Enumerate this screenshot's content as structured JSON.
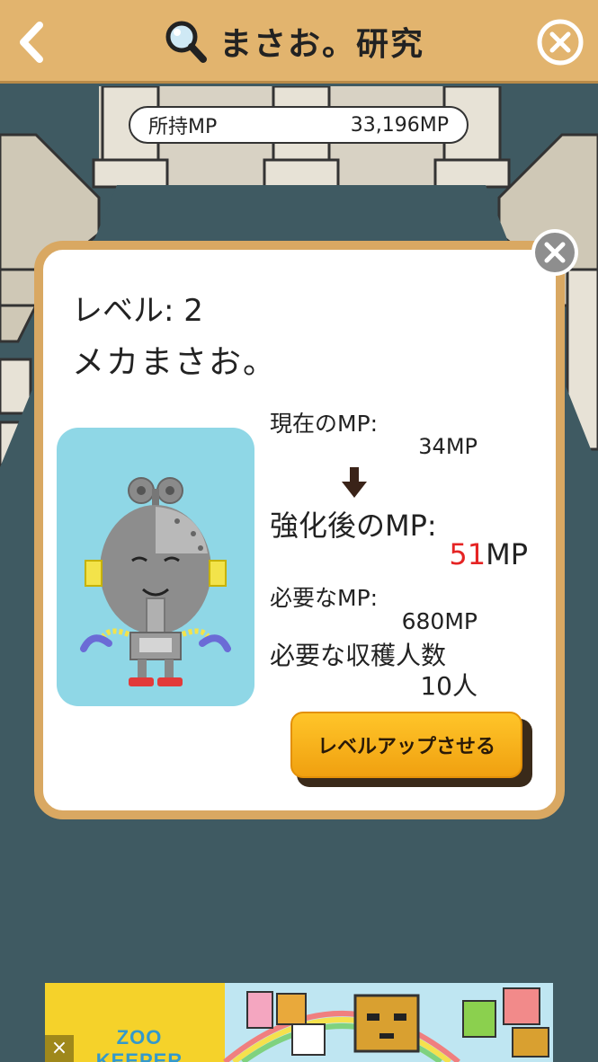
{
  "header": {
    "title": "まさお。研究",
    "back_icon": "chevron-left-icon",
    "search_icon": "magnifier-icon",
    "close_icon": "close-circle-icon"
  },
  "mp_holdings": {
    "label": "所持MP",
    "value": "33,196MP"
  },
  "modal": {
    "level_text": "レベル: 2",
    "character_name": "メカまさお。",
    "current_mp_label": "現在のMP:",
    "current_mp_value": "34MP",
    "after_label": "強化後のMP:",
    "after_number": "51",
    "after_unit": "MP",
    "required_mp_label": "必要なMP:",
    "required_mp_value": "680MP",
    "required_people_label": "必要な収穫人数",
    "required_people_value": "10人",
    "levelup_button": "レベルアップさせる",
    "arrow_icon": "arrow-down-icon"
  },
  "ad": {
    "logo_text": "ZOO KEEPER",
    "close_icon": "close-icon"
  },
  "colors": {
    "header_bg": "#e2b46e",
    "modal_border": "#d9a862",
    "card_bg": "#8fd7e6",
    "button_bg": "#ffc529",
    "highlight_red": "#e52424"
  }
}
